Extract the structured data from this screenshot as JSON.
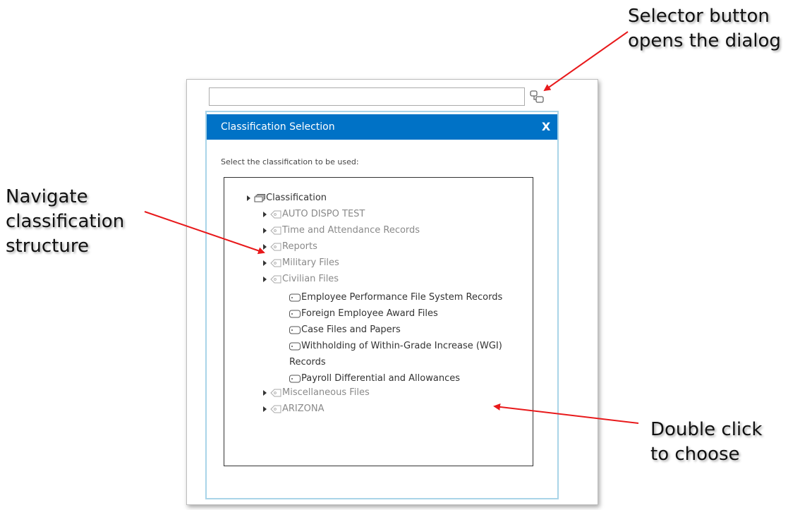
{
  "annotations": {
    "selector": [
      "Selector button",
      "opens the dialog"
    ],
    "navigate": [
      "Navigate",
      "classification",
      "structure"
    ],
    "double_click": [
      "Double click",
      "to choose"
    ]
  },
  "dialog": {
    "title": "Classification Selection",
    "close_label": "X",
    "instruction": "Select the classification to be used:"
  },
  "tree": {
    "root": "Classification",
    "children": [
      "AUTO DISPO TEST",
      "Time and Attendance Records",
      "Reports",
      "Military Files",
      "Civilian Files"
    ],
    "civilian_files_children": [
      "Employee Performance File System Records",
      "Foreign Employee Award Files",
      "Case Files and Papers",
      "Withholding of Within-Grade Increase (WGI)",
      "Records",
      "Payroll Differential and Allowances"
    ],
    "more_children": [
      "Miscellaneous Files",
      "ARIZONA"
    ]
  },
  "colors": {
    "titlebar": "#0072c6",
    "dialog_border": "#a9d4e8",
    "arrow": "#e8191b",
    "category_text": "#8a8a8a",
    "leaf_text": "#333333"
  },
  "icons": {
    "selector": "selector-icon",
    "root": "stack-icon",
    "category": "tag-icon",
    "leaf": "label-icon",
    "expander": "triangle-right-icon"
  }
}
